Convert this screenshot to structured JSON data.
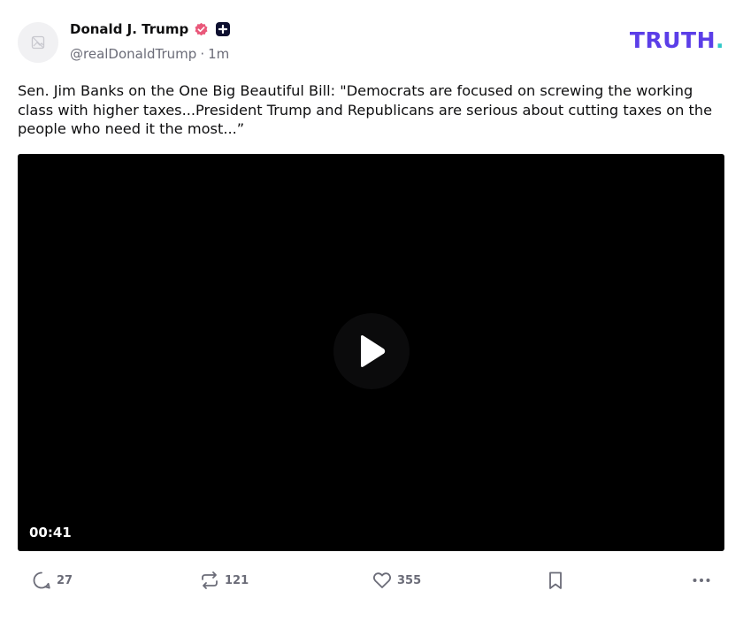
{
  "author": {
    "display_name": "Donald J. Trump",
    "handle": "@realDonaldTrump",
    "separator": "·",
    "time": "1m",
    "verified_icon": "verified-badge-icon",
    "verified_color": "#e9587a",
    "plus_icon": "plus-badge-icon",
    "avatar_icon": "image-placeholder-icon"
  },
  "brand": {
    "logo_text": "TRUTH",
    "logo_dot": ".",
    "color": "#5b3ee8",
    "dot_color": "#2ec8c8"
  },
  "post": {
    "text": "Sen. Jim Banks on the One Big Beautiful Bill: \"Democrats are focused on screwing the working class with higher taxes...President Trump and Republicans are serious about cutting taxes on the people who need it the most...”"
  },
  "video": {
    "duration": "00:41",
    "play_icon": "play-icon"
  },
  "actions": {
    "replies": {
      "icon": "reply-icon",
      "count": "27"
    },
    "retruths": {
      "icon": "retruth-icon",
      "count": "121"
    },
    "likes": {
      "icon": "heart-icon",
      "count": "355"
    },
    "bookmark": {
      "icon": "bookmark-icon"
    },
    "more": {
      "icon": "more-icon"
    }
  }
}
